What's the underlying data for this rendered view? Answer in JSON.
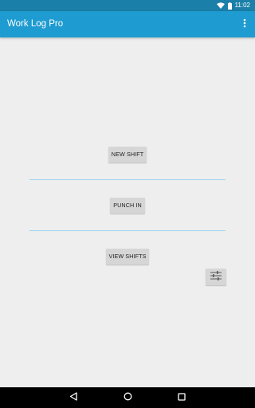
{
  "status_bar": {
    "time": "11:02",
    "icons": [
      "wifi-icon",
      "battery-icon"
    ]
  },
  "app_bar": {
    "title": "Work Log Pro",
    "overflow_icon": "more-vert-icon"
  },
  "main": {
    "new_shift_label": "NEW SHIFT",
    "punch_in_label": "PUNCH IN",
    "view_shifts_label": "VIEW SHIFTS",
    "filter_icon": "tune-icon"
  },
  "nav_bar": {
    "icons": [
      "back-icon",
      "home-icon",
      "recents-icon"
    ]
  },
  "colors": {
    "status_bar": "#1a7fa9",
    "app_bar": "#1e9bd0",
    "background": "#eeeeee",
    "divider": "#9fd3ef",
    "button": "#d6d6d6"
  }
}
